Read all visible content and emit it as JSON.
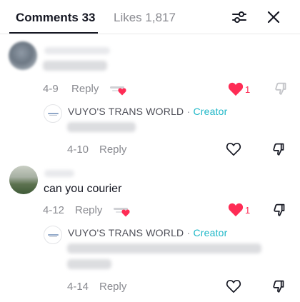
{
  "header": {
    "tabs": [
      {
        "label": "Comments",
        "count": "33",
        "active": true
      },
      {
        "label": "Likes",
        "count": "1,817",
        "active": false
      }
    ],
    "icons": {
      "filter": "filter-sliders-icon",
      "close": "close-icon"
    }
  },
  "comments": [
    {
      "date": "4-9",
      "reply_label": "Reply",
      "liked_by_creator": true,
      "liked": true,
      "likes": "1",
      "replies": [
        {
          "author": "VUYO'S TRANS WORLD",
          "separator": "·",
          "badge": "Creator",
          "date": "4-10",
          "reply_label": "Reply",
          "liked": false
        }
      ]
    },
    {
      "text": "can you courier",
      "date": "4-12",
      "reply_label": "Reply",
      "liked_by_creator": true,
      "liked": true,
      "likes": "1",
      "replies": [
        {
          "author": "VUYO'S TRANS WORLD",
          "separator": "·",
          "badge": "Creator",
          "date": "4-14",
          "reply_label": "Reply",
          "liked": false
        }
      ]
    }
  ],
  "colors": {
    "accent_like": "#fe2c55",
    "creator_badge": "#20b8c8",
    "muted_text": "#8a8b91",
    "primary_text": "#161823"
  }
}
